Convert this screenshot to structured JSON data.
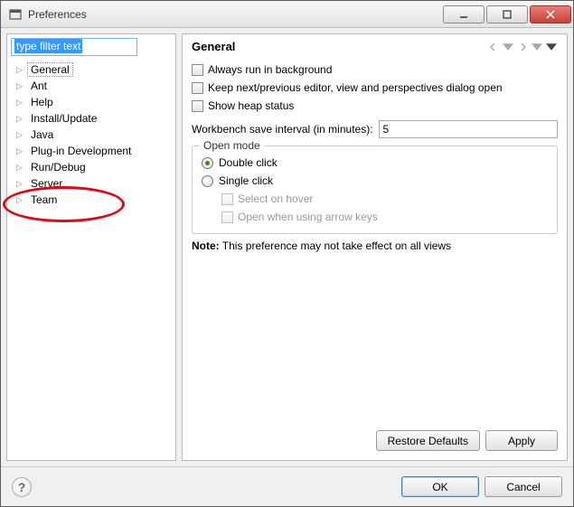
{
  "window": {
    "title": "Preferences"
  },
  "filter": {
    "placeholder": "type filter text"
  },
  "tree": {
    "items": [
      {
        "label": "General",
        "selected": true
      },
      {
        "label": "Ant"
      },
      {
        "label": "Help"
      },
      {
        "label": "Install/Update"
      },
      {
        "label": "Java"
      },
      {
        "label": "Plug-in Development"
      },
      {
        "label": "Run/Debug"
      },
      {
        "label": "Server"
      },
      {
        "label": "Team"
      }
    ]
  },
  "page": {
    "title": "General",
    "chk_background": "Always run in background",
    "chk_keep": "Keep next/previous editor, view and perspectives dialog open",
    "chk_heap": "Show heap status",
    "interval_label": "Workbench save interval (in minutes):",
    "interval_value": "5",
    "open_mode": {
      "legend": "Open mode",
      "double": "Double click",
      "single": "Single click",
      "hover": "Select on hover",
      "arrow": "Open when using arrow keys"
    },
    "note_label": "Note:",
    "note_text": "This preference may not take effect on all views"
  },
  "buttons": {
    "restore": "Restore Defaults",
    "apply": "Apply",
    "ok": "OK",
    "cancel": "Cancel"
  }
}
